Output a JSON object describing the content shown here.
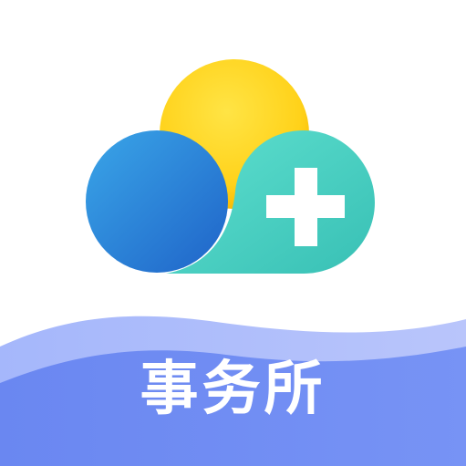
{
  "app": {
    "label": "事务所"
  },
  "icons": {
    "logo": "cloud-sun-plus-logo"
  },
  "colors": {
    "background": "#ffffff",
    "sun": "#ffd21a",
    "cloud_blue": "#2f8ee0",
    "cloud_teal": "#4fd8c6",
    "plus": "#ffffff",
    "wave_light": "#a8b9fb",
    "wave_dark": "#6e8af3",
    "label_text": "#ffffff"
  }
}
